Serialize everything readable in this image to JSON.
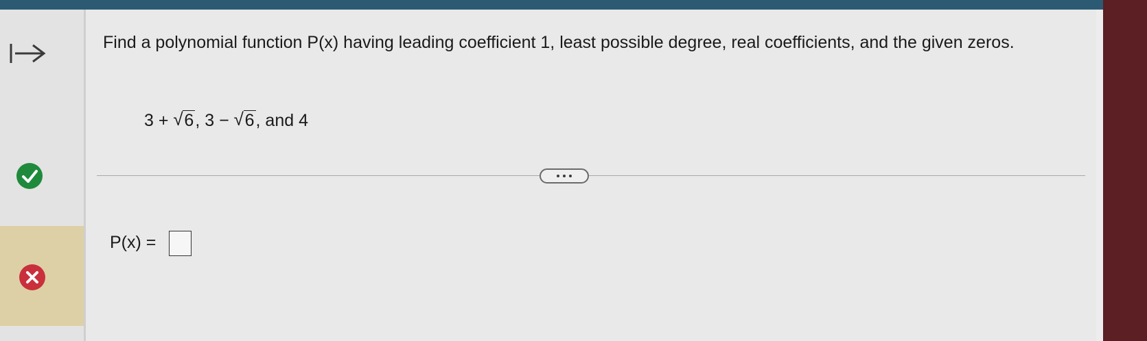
{
  "question": {
    "text": "Find a polynomial function P(x) having leading coefficient 1, least possible degree, real coefficients, and the given zeros."
  },
  "zeros": {
    "z1_prefix": "3 + ",
    "z1_radicand": "6",
    "sep": ", ",
    "z2_prefix": "3 − ",
    "z2_radicand": "6",
    "tail": ", and 4"
  },
  "answer": {
    "label": "P(x) ="
  },
  "icons": {
    "arrow": "arrow-right-bar-icon",
    "correct": "check-circle-icon",
    "incorrect": "x-circle-icon",
    "more": "ellipsis-icon"
  },
  "colors": {
    "top_bar": "#2c5a73",
    "check": "#1f8a3b",
    "x_mark": "#c9303b",
    "highlight": "#ddd0a6"
  }
}
